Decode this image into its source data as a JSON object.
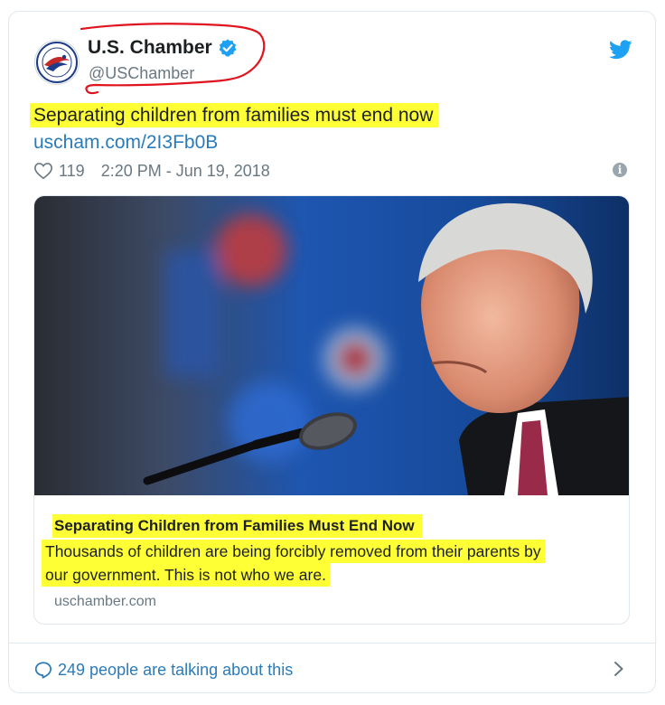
{
  "author": {
    "name": "U.S. Chamber",
    "handle": "@USChamber"
  },
  "tweet": {
    "text": "Separating children from families must end now",
    "link": "uscham.com/2I3Fb0B",
    "likes": "119",
    "timestamp": "2:20 PM - Jun 19, 2018"
  },
  "link_card": {
    "title": "Separating Children from Families Must End Now",
    "description_line1": "Thousands of children are being forcibly removed from their parents by",
    "description_line2": "our government. This is not who we are.",
    "domain": "uschamber.com"
  },
  "footer": {
    "conversation": "249 people are talking about this"
  },
  "colors": {
    "highlight": "#ffff36",
    "annotation_ink": "#e0141e",
    "link_blue": "#2b7bb9",
    "twitter_blue": "#1da1f2",
    "muted_text": "#697882"
  },
  "icons": [
    "chamber-logo",
    "verified-badge-icon",
    "twitter-bird-icon",
    "heart-icon",
    "info-icon",
    "speech-bubble-icon",
    "chevron-right-icon"
  ]
}
